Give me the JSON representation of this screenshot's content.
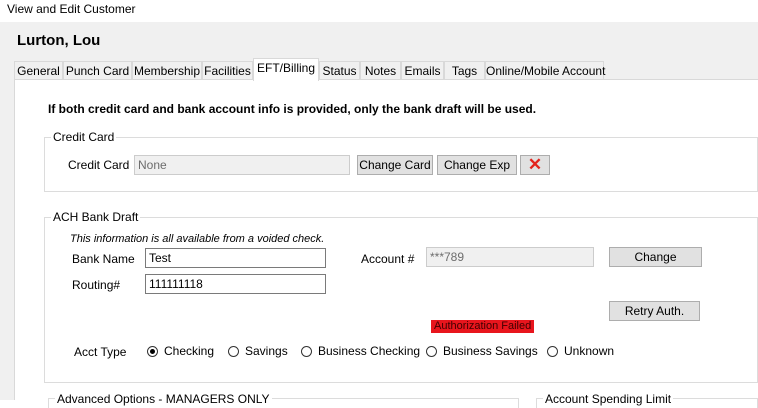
{
  "window": {
    "title": "View and Edit Customer"
  },
  "customer": {
    "name": "Lurton, Lou"
  },
  "tabs": [
    {
      "label": "General"
    },
    {
      "label": "Punch Card"
    },
    {
      "label": "Membership"
    },
    {
      "label": "Facilities"
    },
    {
      "label": "EFT/Billing",
      "active": true
    },
    {
      "label": "Status"
    },
    {
      "label": "Notes"
    },
    {
      "label": "Emails"
    },
    {
      "label": "Tags"
    },
    {
      "label": "Online/Mobile Account"
    }
  ],
  "notice": "If both credit card and bank account info is provided, only the bank draft will be used.",
  "credit_card": {
    "group_title": "Credit Card",
    "label": "Credit Card",
    "value": "None",
    "change_card_label": "Change Card",
    "change_exp_label": "Change Exp",
    "delete_glyph": "✕"
  },
  "ach": {
    "group_title": "ACH Bank Draft",
    "info": "This information is all available from a voided check.",
    "bank_name_label": "Bank Name",
    "bank_name_value": "Test",
    "routing_label": "Routing#",
    "routing_value": "111111118",
    "account_label": "Account #",
    "account_value": "***789",
    "change_label": "Change",
    "auth_status": "Authorization Failed",
    "retry_label": "Retry Auth.",
    "acct_type_label": "Acct Type",
    "acct_types": [
      {
        "label": "Checking",
        "checked": true
      },
      {
        "label": "Savings",
        "checked": false
      },
      {
        "label": "Business Checking",
        "checked": false
      },
      {
        "label": "Business Savings",
        "checked": false
      },
      {
        "label": "Unknown",
        "checked": false
      }
    ]
  },
  "advanced_options": {
    "group_title": "Advanced Options - MANAGERS ONLY"
  },
  "spending_limit": {
    "group_title": "Account Spending Limit"
  }
}
